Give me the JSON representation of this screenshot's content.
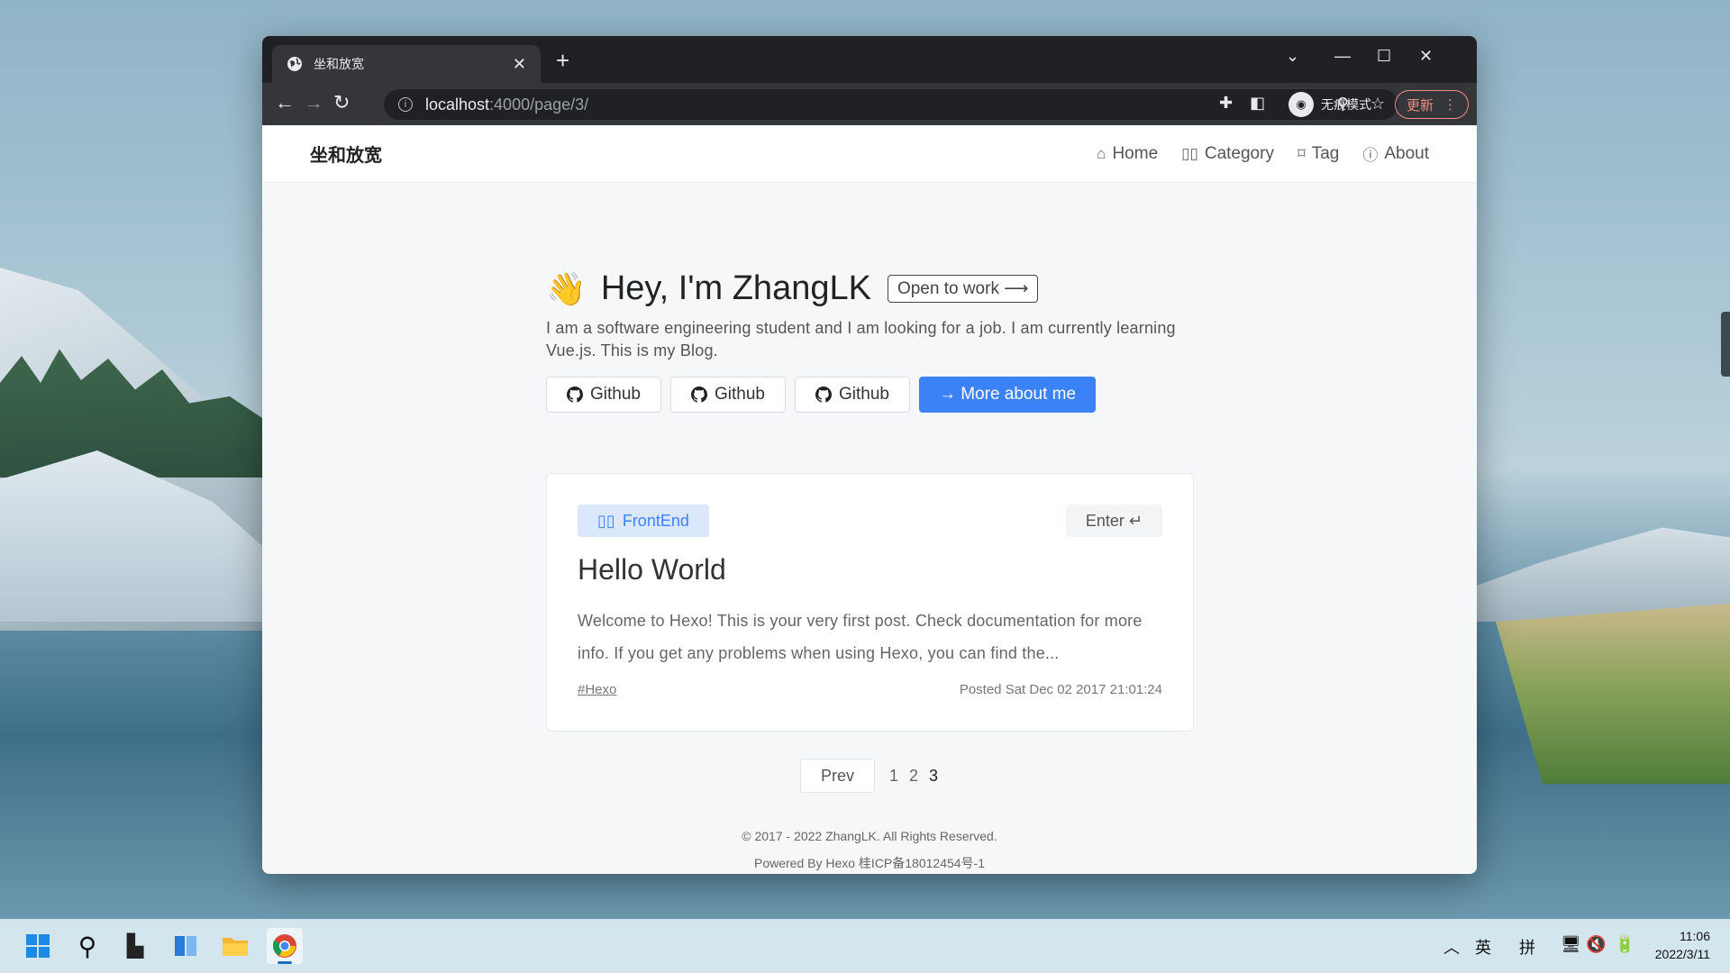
{
  "browser": {
    "tab_title": "坐和放宽",
    "url_host": "localhost",
    "url_rest": ":4000/page/3/",
    "incognito_label": "无痕模式",
    "update_label": "更新"
  },
  "site": {
    "logo": "坐和放宽",
    "nav": [
      {
        "label": "Home",
        "icon": "home-icon"
      },
      {
        "label": "Category",
        "icon": "book-icon"
      },
      {
        "label": "Tag",
        "icon": "bookmark-icon"
      },
      {
        "label": "About",
        "icon": "info-icon"
      }
    ]
  },
  "hero": {
    "wave": "👋",
    "title": "Hey, I'm ZhangLK",
    "open_to_work": "Open to work ⟶",
    "description": "I am a software engineering student and I am looking for a job. I am currently learning Vue.js. This is my Blog.",
    "buttons": [
      "Github",
      "Github",
      "Github"
    ],
    "more_button": "→  More about me"
  },
  "post": {
    "category": "FrontEnd",
    "enter_label": "Enter ↵",
    "title": "Hello World",
    "excerpt": "Welcome to Hexo! This is your very first post. Check documentation for more info. If you get any problems when using Hexo, you can find the...",
    "tag": "#Hexo",
    "posted": "Posted Sat Dec 02 2017 21:01:24"
  },
  "pagination": {
    "prev_label": "Prev",
    "pages": [
      "1",
      "2",
      "3"
    ],
    "current": "3"
  },
  "footer": {
    "copyright": "© 2017 - 2022 ZhangLK. All Rights Reserved.",
    "powered": "Powered By Hexo 桂ICP备18012454号-1"
  },
  "taskbar": {
    "tray_lang": "英",
    "tray_ime": "拼",
    "time": "11:06",
    "date": "2022/3/11"
  },
  "colors": {
    "accent": "#3b82f6",
    "badge_bg": "#dbe8fb",
    "update": "#f28b82"
  }
}
